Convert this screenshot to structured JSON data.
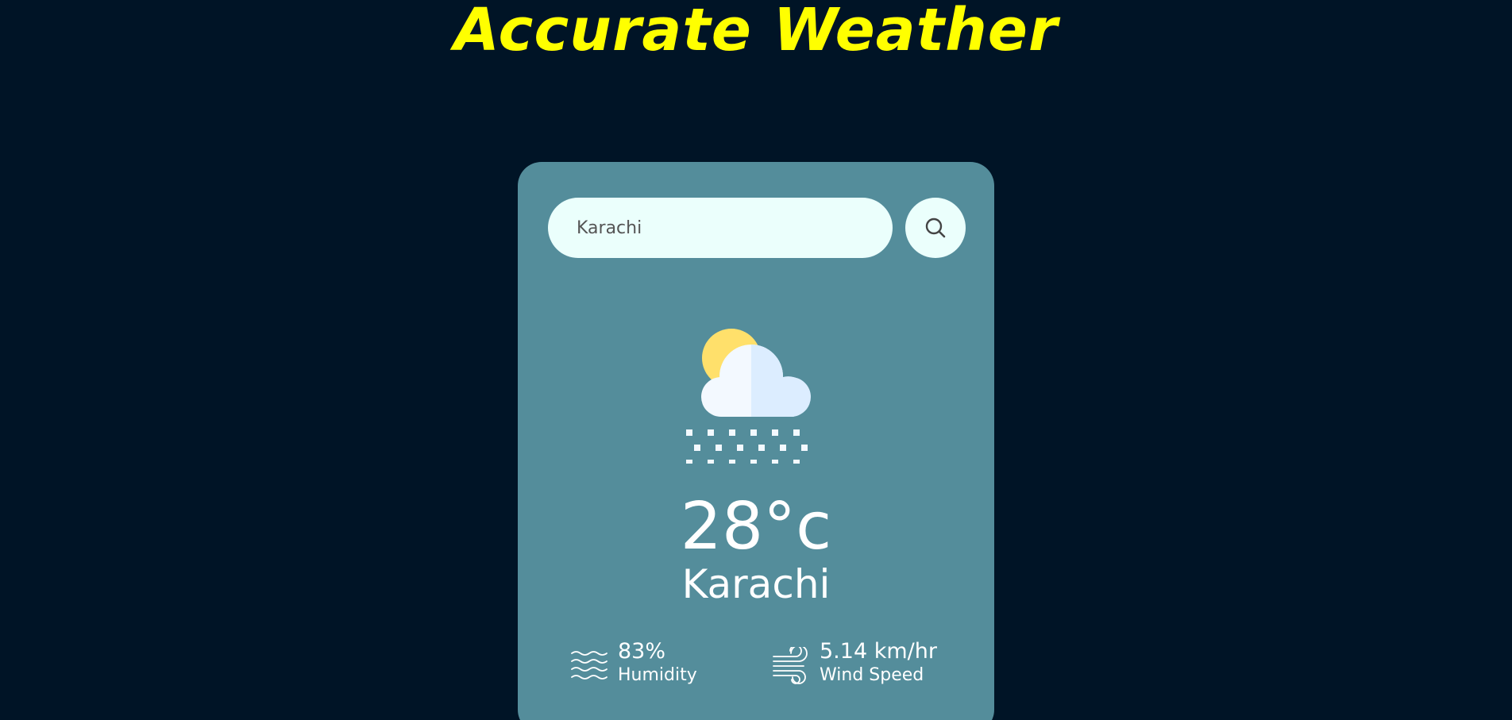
{
  "header": {
    "title": "Accurate Weather"
  },
  "search": {
    "value": "Karachi",
    "icon": "search-icon"
  },
  "weather": {
    "icon": "cloud-sun-snow-icon",
    "temperature": "28°c",
    "city": "Karachi"
  },
  "details": {
    "humidity": {
      "value": "83%",
      "label": "Humidity",
      "icon": "humidity-waves-icon"
    },
    "wind": {
      "value": "5.14 km/hr",
      "label": "Wind Speed",
      "icon": "wind-icon"
    }
  },
  "colors": {
    "background": "#001426",
    "title": "#ffff00",
    "card": "#548d9b",
    "input": "#ebfffc",
    "text": "#ffffff"
  }
}
